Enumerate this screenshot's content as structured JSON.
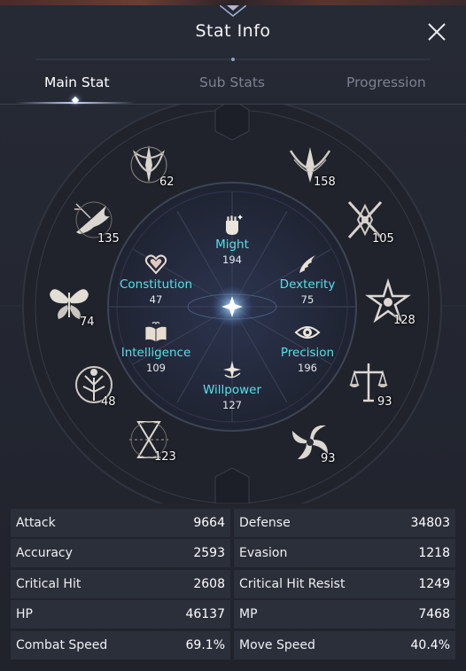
{
  "window": {
    "title": "Stat Info"
  },
  "tabs": [
    {
      "label": "Main Stat",
      "active": true
    },
    {
      "label": "Sub Stats",
      "active": false
    },
    {
      "label": "Progression",
      "active": false
    }
  ],
  "inner_stats": {
    "might": {
      "label": "Might",
      "value": "194",
      "icon": "fist-icon"
    },
    "constitution": {
      "label": "Constitution",
      "value": "47",
      "icon": "heart-icon"
    },
    "dexterity": {
      "label": "Dexterity",
      "value": "75",
      "icon": "wing-icon"
    },
    "intelligence": {
      "label": "Intelligence",
      "value": "109",
      "icon": "book-icon"
    },
    "precision": {
      "label": "Precision",
      "value": "196",
      "icon": "eye-icon"
    },
    "willpower": {
      "label": "Willpower",
      "value": "127",
      "icon": "sparkle-icon"
    }
  },
  "outer_emblems": [
    {
      "icon": "sword-crest-icon",
      "value": "62"
    },
    {
      "icon": "winged-crest-icon",
      "value": "158"
    },
    {
      "icon": "bird-crest-icon",
      "value": "135"
    },
    {
      "icon": "crossed-blades-icon",
      "value": "105"
    },
    {
      "icon": "butterfly-icon",
      "value": "74"
    },
    {
      "icon": "star-crest-icon",
      "value": "128"
    },
    {
      "icon": "tree-crest-icon",
      "value": "48"
    },
    {
      "icon": "scales-icon",
      "value": "93"
    },
    {
      "icon": "hourglass-icon",
      "value": "123"
    },
    {
      "icon": "swirl-icon",
      "value": "93"
    }
  ],
  "stats_table": [
    {
      "left_label": "Attack",
      "left_value": "9664",
      "right_label": "Defense",
      "right_value": "34803"
    },
    {
      "left_label": "Accuracy",
      "left_value": "2593",
      "right_label": "Evasion",
      "right_value": "1218"
    },
    {
      "left_label": "Critical Hit",
      "left_value": "2608",
      "right_label": "Critical Hit Resist",
      "right_value": "1249"
    },
    {
      "left_label": "HP",
      "left_value": "46137",
      "right_label": "MP",
      "right_value": "7468"
    },
    {
      "left_label": "Combat Speed",
      "left_value": "69.1%",
      "right_label": "Move Speed",
      "right_value": "40.4%"
    }
  ],
  "colors": {
    "accent_cyan": "#58e0ea",
    "panel": "#262a35",
    "row_bg": "#2b2f3a"
  }
}
